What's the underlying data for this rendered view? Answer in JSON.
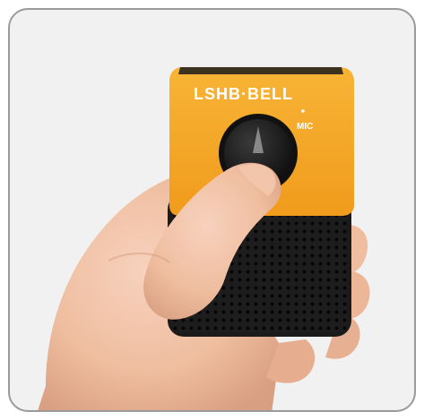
{
  "product": {
    "brand_label": "LSHB·BELL",
    "mic_label": "MIC"
  },
  "colors": {
    "frame_border": "#9a9a9a",
    "frame_background": "#f1f1f1",
    "device_panel": "#f5a623",
    "device_body": "#1b1b1b",
    "skin": "#f2c4a9"
  },
  "icons": {
    "mic_indicator": "mic-dot-icon"
  }
}
